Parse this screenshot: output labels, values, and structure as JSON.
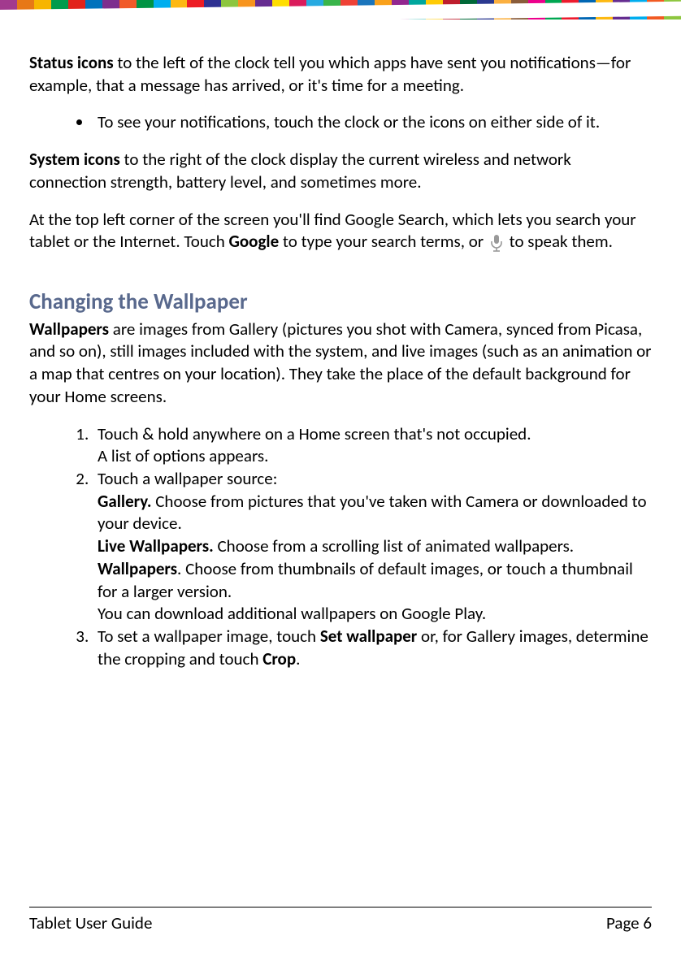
{
  "stripes": [
    "#a23a8e",
    "#e77817",
    "#f7b500",
    "#009b4c",
    "#e2231a",
    "#0072bc",
    "#7d2e8e",
    "#f15a29",
    "#009444",
    "#00aeef",
    "#fdb813",
    "#ed1c24",
    "#2e3192",
    "#8cc63f",
    "#f7941e",
    "#662d91",
    "#ffde00",
    "#da1c5c",
    "#27aae1",
    "#39b54a",
    "#ef4136",
    "#1b75bc",
    "#f9a11b",
    "#92278f",
    "#00a79d",
    "#ffcb05",
    "#be1e2d",
    "#006838",
    "#2b3990",
    "#fbb040",
    "#8a5d3b",
    "#ec008c",
    "#00a651",
    "#ed1b2e",
    "#0066b3",
    "#fdb912",
    "#652d90",
    "#00adee",
    "#f15a22",
    "#8dc63f"
  ],
  "p1": {
    "bold": "Status icons",
    "text": " to the left of the clock tell you which apps have sent you notifications—for example, that a message has arrived, or it's time for a meeting."
  },
  "bullet1": "To see your notifications, touch the clock or the icons on either side of it.",
  "p2": {
    "bold": "System icons",
    "text": " to the right of the clock display the current wireless and network connection strength, battery level, and sometimes more."
  },
  "p3": {
    "pre": "At the top left corner of the screen you'll find Google Search, which lets you search your tablet or the Internet. Touch ",
    "bold": "Google",
    "mid": " to type your search terms, or ",
    "post": " to speak them."
  },
  "heading": "Changing the Wallpaper",
  "p4": {
    "bold": "Wallpapers",
    "text": " are images from Gallery (pictures you shot with Camera, synced from Picasa, and so on), still images included with the system, and live images (such as an animation or a map that centres on your location). They take the place of the default background for your Home screens."
  },
  "steps": {
    "s1a": "Touch & hold anywhere on a Home screen that's not occupied.",
    "s1b": "A list of options appears.",
    "s2a": "Touch a wallpaper source:",
    "s2_gallery_b": "Gallery.",
    "s2_gallery_t": " Choose from pictures that you've taken with Camera or downloaded to your device.",
    "s2_live_b": "Live Wallpapers.",
    "s2_live_t": " Choose from a scrolling list of animated wallpapers.",
    "s2_wall_b": "Wallpapers",
    "s2_wall_t": ". Choose from thumbnails of default images, or touch a thumbnail for a larger version.",
    "s2_dl": "You can download additional wallpapers on Google Play.",
    "s3_pre": "To set a wallpaper image, touch ",
    "s3_b1": "Set wallpaper",
    "s3_mid": " or, for Gallery images, determine the cropping and touch ",
    "s3_b2": "Crop",
    "s3_post": "."
  },
  "footer": {
    "left": "Tablet User Guide",
    "right": "Page 6"
  }
}
